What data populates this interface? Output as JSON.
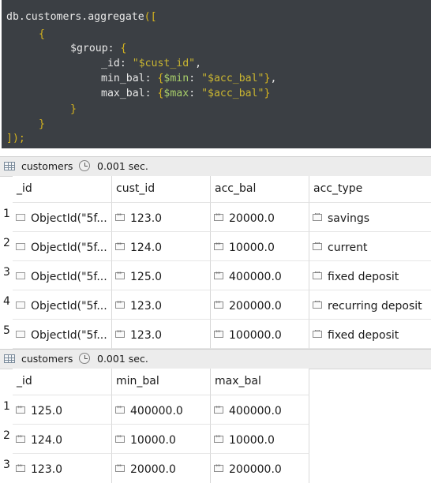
{
  "code": {
    "l1_def": "db.customers.aggregate",
    "l1_br": "([",
    "l2_br": "{",
    "l3_key": "$group",
    "l3_colon": ": ",
    "l3_br": "{",
    "l4_key": "_id",
    "l4_colon": ": ",
    "l4_str": "\"$cust_id\"",
    "l4_comma": ",",
    "l5_key": "min_bal",
    "l5_colon": ": ",
    "l5_br1": "{",
    "l5_op": "$min",
    "l5_colon2": ": ",
    "l5_str": "\"$acc_bal\"",
    "l5_br2": "}",
    "l5_comma": ",",
    "l6_key": "max_bal",
    "l6_colon": ": ",
    "l6_br1": "{",
    "l6_op": "$max",
    "l6_colon2": ": ",
    "l6_str": "\"$acc_bal\"",
    "l6_br2": "}",
    "l7_br": "}",
    "l8_br": "}",
    "l9_br": "]);"
  },
  "result1": {
    "collection": "customers",
    "time": "0.001 sec.",
    "headers": [
      "_id",
      "cust_id",
      "acc_bal",
      "acc_type"
    ],
    "rows": [
      {
        "num": "1",
        "id": "ObjectId(\"5f...",
        "cust_id": "123.0",
        "acc_bal": "20000.0",
        "acc_type": "savings"
      },
      {
        "num": "2",
        "id": "ObjectId(\"5f...",
        "cust_id": "124.0",
        "acc_bal": "10000.0",
        "acc_type": "current"
      },
      {
        "num": "3",
        "id": "ObjectId(\"5f...",
        "cust_id": "125.0",
        "acc_bal": "400000.0",
        "acc_type": "fixed deposit"
      },
      {
        "num": "4",
        "id": "ObjectId(\"5f...",
        "cust_id": "123.0",
        "acc_bal": "200000.0",
        "acc_type": "recurring deposit"
      },
      {
        "num": "5",
        "id": "ObjectId(\"5f...",
        "cust_id": "123.0",
        "acc_bal": "100000.0",
        "acc_type": "fixed deposit"
      }
    ]
  },
  "result2": {
    "collection": "customers",
    "time": "0.001 sec.",
    "headers": [
      "_id",
      "min_bal",
      "max_bal"
    ],
    "rows": [
      {
        "num": "1",
        "id": "125.0",
        "min_bal": "400000.0",
        "max_bal": "400000.0"
      },
      {
        "num": "2",
        "id": "124.0",
        "min_bal": "10000.0",
        "max_bal": "10000.0"
      },
      {
        "num": "3",
        "id": "123.0",
        "min_bal": "20000.0",
        "max_bal": "200000.0"
      }
    ]
  },
  "icons": {
    "grid": "table-grid-icon",
    "clock": "clock-icon",
    "object": "object-type-icon",
    "number": "number-type-icon",
    "string": "string-type-icon"
  }
}
